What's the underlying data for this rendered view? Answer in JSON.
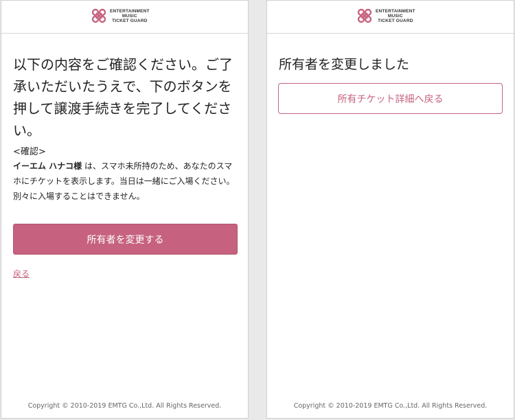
{
  "brand": {
    "line1": "ENTERTAINMENT",
    "line2": "MUSIC",
    "line3": "TICKET GUARD",
    "color": "#c6627f"
  },
  "left": {
    "heading": "以下の内容をご確認ください。ご了承いただいたうえで、下のボタンを押して譲渡手続きを完了してください。",
    "confirm_label": "<確認>",
    "confirm_name": "イーエム ハナコ様",
    "confirm_text": " は、スマホ未所持のため、あなたのスマホにチケットを表示します。当日は一緒にご入場ください。別々に入場することはできません。",
    "primary_button": "所有者を変更する",
    "back_link": "戻る"
  },
  "right": {
    "heading": "所有者を変更しました",
    "outline_button": "所有チケット詳細へ戻る"
  },
  "footer": {
    "copyright": "Copyright © 2010-2019 EMTG Co.,Ltd. All Rights Reserved."
  }
}
